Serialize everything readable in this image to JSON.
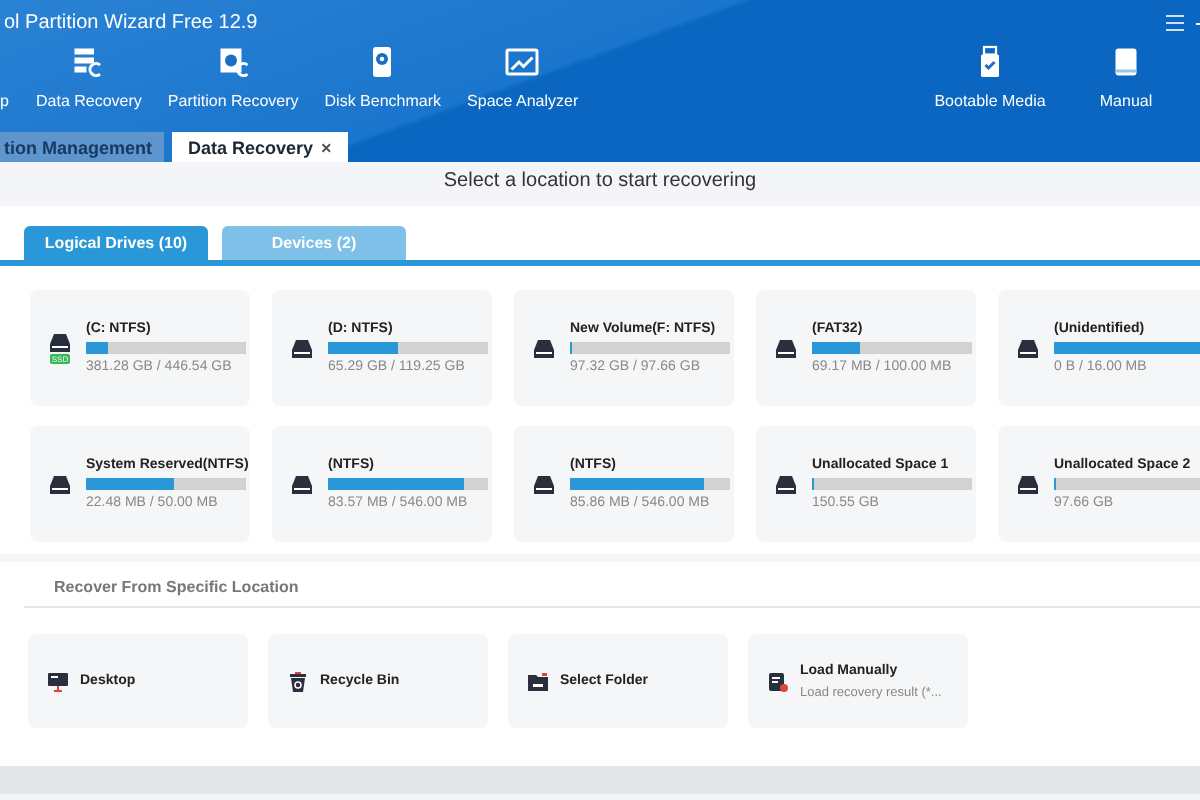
{
  "window": {
    "title": "ol Partition Wizard Free 12.9"
  },
  "toolbar_cut_label": "p",
  "toolbar": [
    {
      "label": "Data Recovery",
      "kind": "data"
    },
    {
      "label": "Partition Recovery",
      "kind": "partition"
    },
    {
      "label": "Disk Benchmark",
      "kind": "benchmark"
    },
    {
      "label": "Space Analyzer",
      "kind": "analyzer"
    }
  ],
  "toolbar_right": [
    {
      "label": "Bootable Media",
      "kind": "usb"
    },
    {
      "label": "Manual",
      "kind": "book"
    }
  ],
  "tabs": [
    {
      "label": "tion Management",
      "selected": false,
      "closable": false
    },
    {
      "label": "Data Recovery",
      "selected": true,
      "closable": true,
      "close": "×"
    }
  ],
  "heading": "Select a location to start recovering",
  "drive_tabs": [
    {
      "label": "Logical Drives (10)",
      "selected": true
    },
    {
      "label": "Devices (2)",
      "selected": false
    }
  ],
  "drives": [
    {
      "name": "(C: NTFS)",
      "size": "381.28 GB / 446.54 GB",
      "level": 0.14,
      "badge": "SSD"
    },
    {
      "name": "(D: NTFS)",
      "size": "65.29 GB / 119.25 GB",
      "level": 0.44
    },
    {
      "name": "New Volume(F: NTFS)",
      "size": "97.32 GB / 97.66 GB",
      "level": 0.0
    },
    {
      "name": "(FAT32)",
      "size": "69.17 MB / 100.00 MB",
      "level": 0.3
    },
    {
      "name": "(Unidentified)",
      "size": "0 B / 16.00 MB",
      "level": 1.0
    },
    {
      "name": "System Reserved(NTFS)",
      "size": "22.48 MB / 50.00 MB",
      "level": 0.55
    },
    {
      "name": "(NTFS)",
      "size": "83.57 MB / 546.00 MB",
      "level": 0.85
    },
    {
      "name": "(NTFS)",
      "size": "85.86 MB / 546.00 MB",
      "level": 0.84
    },
    {
      "name": "Unallocated Space 1",
      "size": "150.55 GB",
      "level": 0.0
    },
    {
      "name": "Unallocated Space 2",
      "size": "97.66 GB",
      "level": 0.0
    }
  ],
  "specific": {
    "title": "Recover From Specific Location",
    "items": [
      {
        "label": "Desktop",
        "kind": "desktop"
      },
      {
        "label": "Recycle Bin",
        "kind": "bin"
      },
      {
        "label": "Select Folder",
        "kind": "folder"
      },
      {
        "label": "Load Manually",
        "kind": "load",
        "detail": "Load recovery result (*..."
      }
    ]
  }
}
